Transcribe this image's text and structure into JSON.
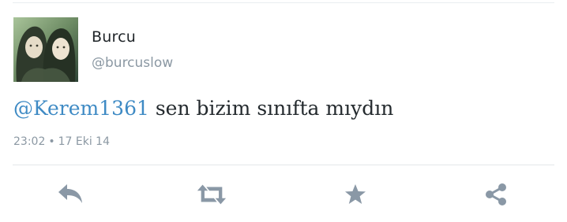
{
  "tweet": {
    "author": {
      "display_name": "Burcu",
      "handle": "@burcuslow",
      "avatar_icon": "profile-photo"
    },
    "text": {
      "mention": "@Kerem1361",
      "body": " sen bizim sınıfta mıydın"
    },
    "meta": {
      "time": "23:02",
      "separator": "•",
      "date": "17 Eki 14"
    }
  },
  "actions": [
    {
      "name": "reply",
      "icon": "reply-icon"
    },
    {
      "name": "retweet",
      "icon": "retweet-icon"
    },
    {
      "name": "favorite",
      "icon": "star-icon"
    },
    {
      "name": "share",
      "icon": "share-icon"
    }
  ],
  "colors": {
    "link": "#3e8ac4",
    "text": "#242a2e",
    "muted": "#8b98a3",
    "icon": "#8a98a6"
  }
}
